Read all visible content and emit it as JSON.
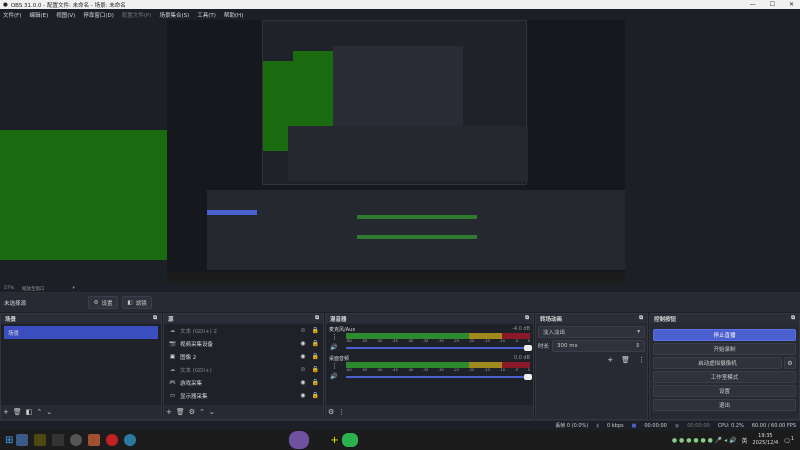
{
  "window": {
    "title": "OBS 31.0.0 - 配置文件: 未命名 - 场景: 未命名"
  },
  "menu": [
    {
      "label": "文件(F)"
    },
    {
      "label": "编辑(E)"
    },
    {
      "label": "视图(V)"
    },
    {
      "label": "停靠窗口(D)"
    },
    {
      "label": "配置文件(P)",
      "disabled": true
    },
    {
      "label": "场景集合(S)"
    },
    {
      "label": "工具(T)"
    },
    {
      "label": "帮助(H)"
    }
  ],
  "preview": {
    "zoom": "57%",
    "zoom_mode": "缩放至窗口"
  },
  "source_bar": {
    "label": "未选择源",
    "settings": "设置",
    "filters": "滤镜"
  },
  "scenes": {
    "title": "场景",
    "items": [
      "场景"
    ],
    "selected": 0
  },
  "sources": {
    "title": "源",
    "items": [
      {
        "name": "文本 (GDI+) 2",
        "icon": "text-icon",
        "visible": false,
        "locked": false
      },
      {
        "name": "视频采集设备",
        "icon": "camera-icon",
        "visible": true,
        "locked": false
      },
      {
        "name": "图像 2",
        "icon": "image-icon",
        "visible": true,
        "locked": false
      },
      {
        "name": "文本 (GDI+)",
        "icon": "text-icon",
        "visible": false,
        "locked": false
      },
      {
        "name": "游戏采集",
        "icon": "gamepad-icon",
        "visible": true,
        "locked": true
      },
      {
        "name": "显示器采集",
        "icon": "monitor-icon",
        "visible": true,
        "locked": true
      }
    ]
  },
  "mixer": {
    "title": "混音器",
    "channels": [
      {
        "name": "麦克风/Aux",
        "level": "-4.0 dB"
      },
      {
        "name": "桌面音频",
        "level": "0.0 dB"
      }
    ],
    "ticks": [
      "-60",
      "-55",
      "-50",
      "-45",
      "-40",
      "-35",
      "-30",
      "-25",
      "-20",
      "-15",
      "-10",
      "-5",
      "0"
    ]
  },
  "transitions": {
    "title": "转场动画",
    "selected": "淡入淡出",
    "duration_label": "时长",
    "duration": "300 ms"
  },
  "controls": {
    "title": "控制按钮",
    "buttons": [
      "停止直播",
      "开始录制",
      "启动虚拟摄像机",
      "工作室模式",
      "设置",
      "退出"
    ]
  },
  "status": {
    "dropped": "丢帧 0 (0.0%)",
    "bitrate": "0 kbps",
    "stream_time": "00:00:00",
    "rec_time": "00:00:00",
    "cpu": "CPU: 0.2%",
    "fps": "60.00 / 60.00 FPS"
  },
  "taskbar": {
    "time": "19:35",
    "date": "2025/12/4",
    "ime": "英",
    "notifications": "1"
  },
  "colors": {
    "accent": "#4a5fd0",
    "green": "#1a6a10"
  }
}
